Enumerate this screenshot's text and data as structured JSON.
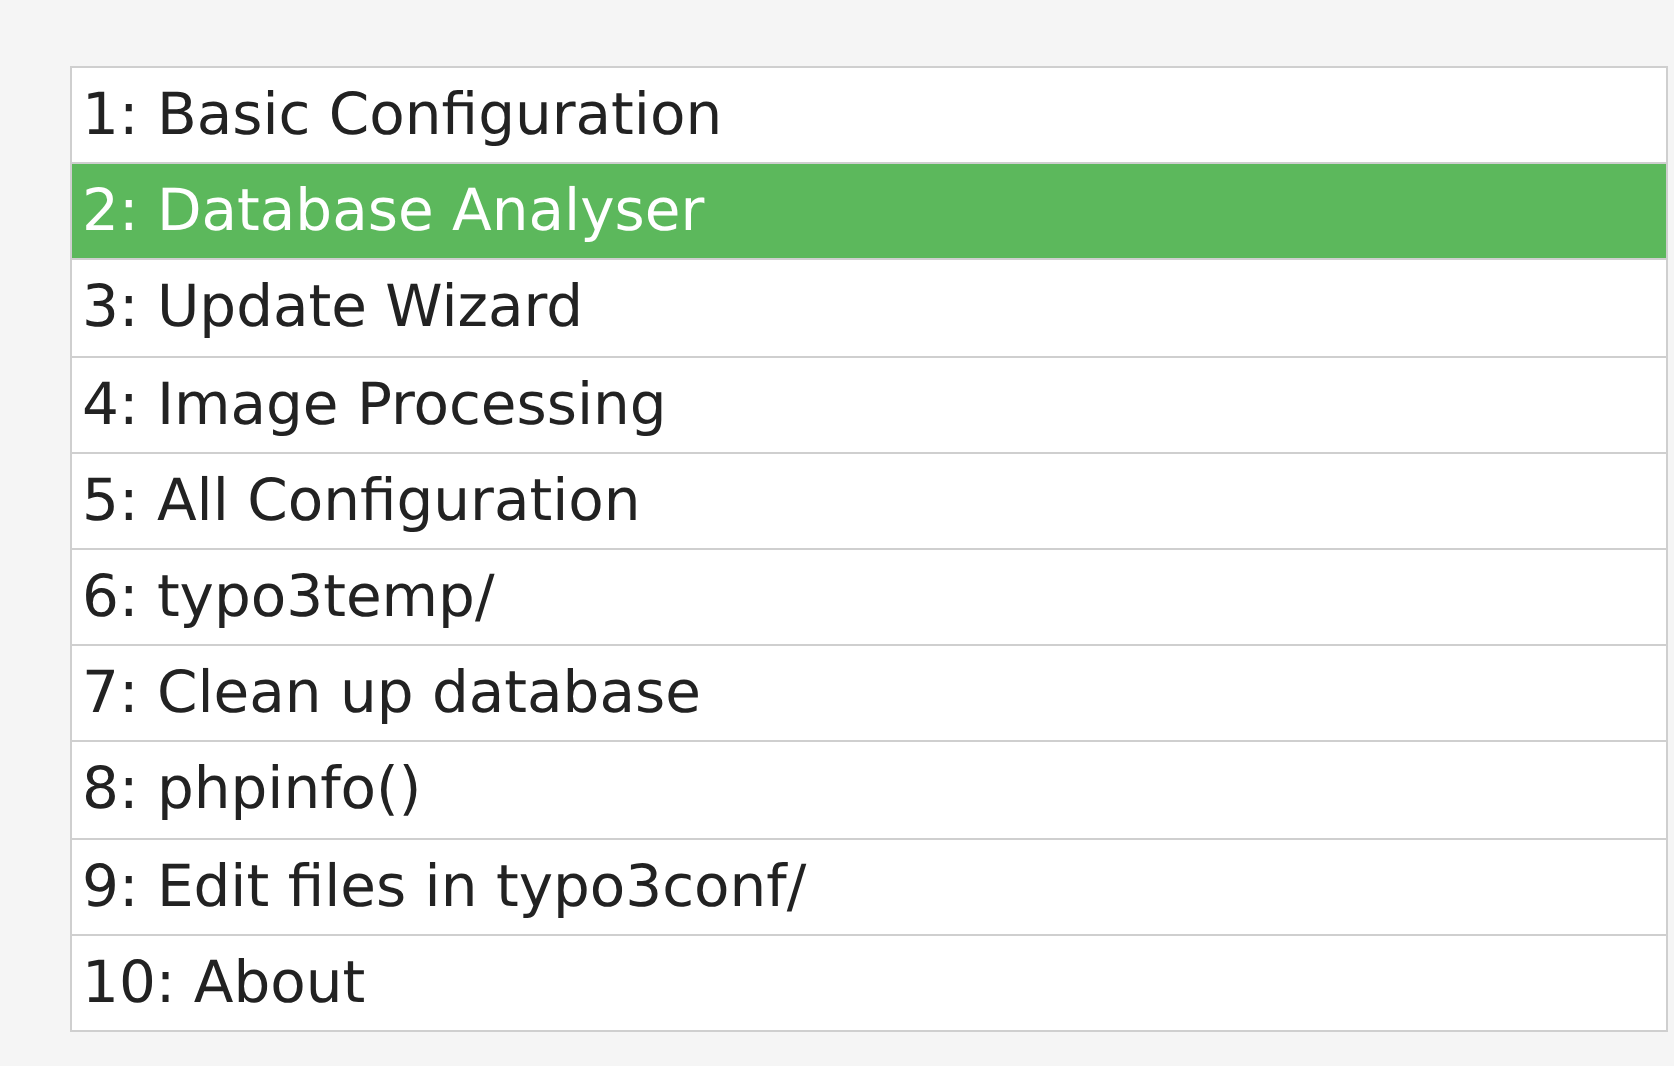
{
  "menu": {
    "items": [
      {
        "label": "1: Basic Configuration",
        "selected": false
      },
      {
        "label": "2: Database Analyser",
        "selected": true
      },
      {
        "label": "3: Update Wizard",
        "selected": false
      },
      {
        "label": "4: Image Processing",
        "selected": false
      },
      {
        "label": "5: All Configuration",
        "selected": false
      },
      {
        "label": "6: typo3temp/",
        "selected": false
      },
      {
        "label": "7: Clean up database",
        "selected": false
      },
      {
        "label": "8: phpinfo()",
        "selected": false
      },
      {
        "label": "9: Edit files in typo3conf/",
        "selected": false
      },
      {
        "label": "10: About",
        "selected": false
      }
    ]
  }
}
